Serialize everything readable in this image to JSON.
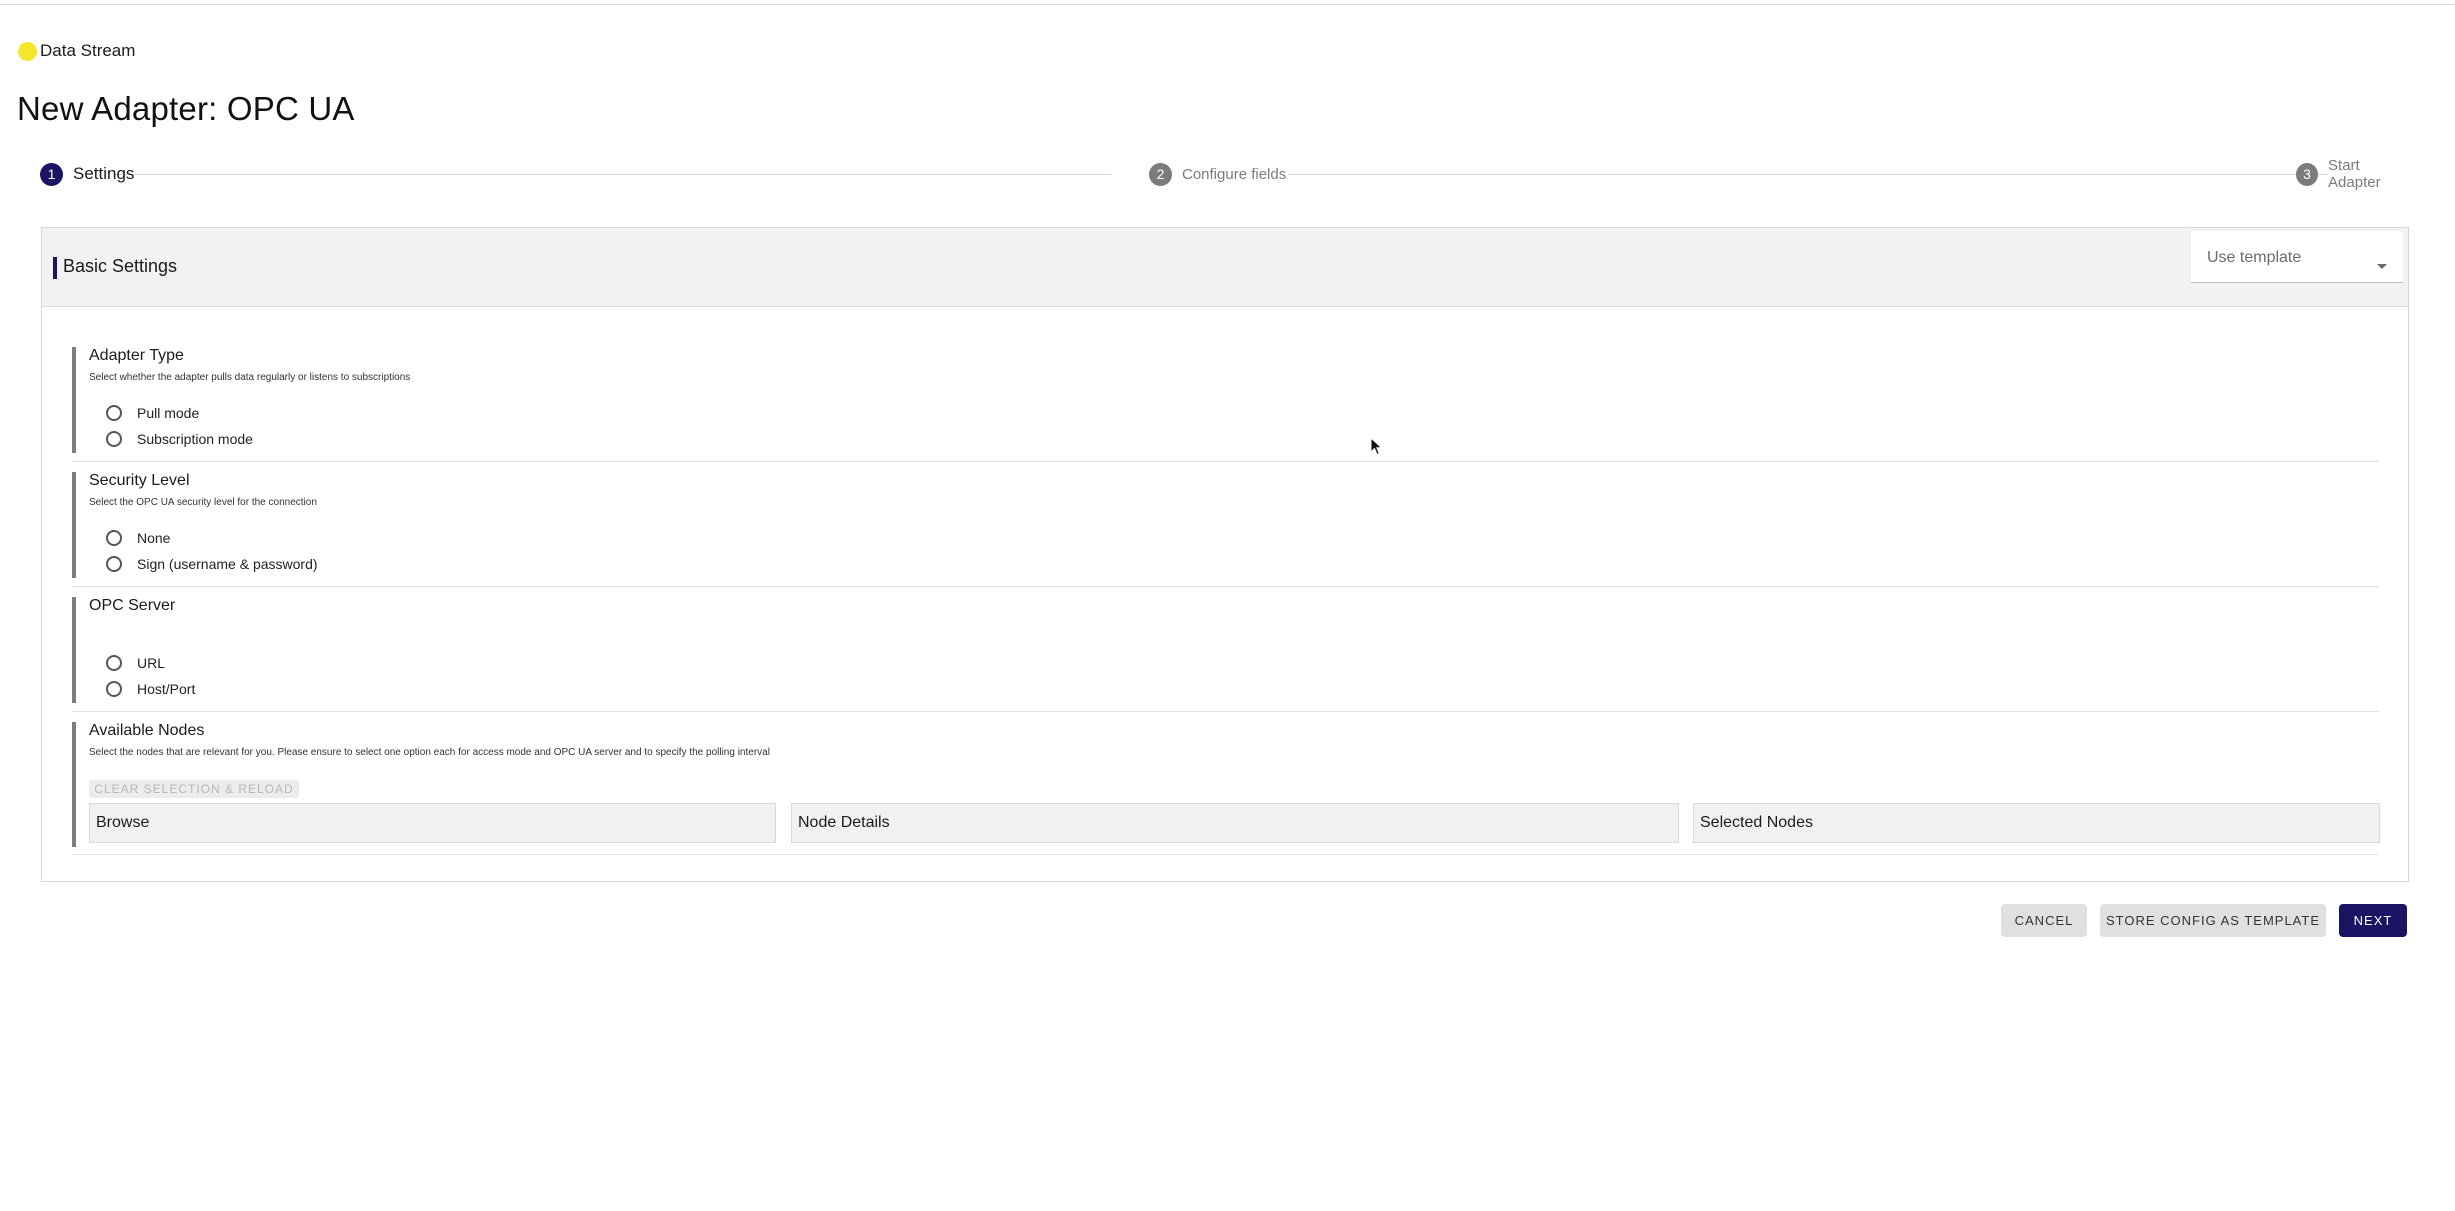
{
  "app": {
    "name": "Data Stream"
  },
  "page": {
    "title": "New Adapter: OPC UA"
  },
  "stepper": {
    "steps": [
      {
        "number": "1",
        "label": "Settings",
        "state": "active"
      },
      {
        "number": "2",
        "label": "Configure fields",
        "state": "inactive"
      },
      {
        "number": "3",
        "label": "Start Adapter",
        "state": "inactive"
      }
    ]
  },
  "settings": {
    "title": "Basic Settings",
    "template_select": {
      "selected": "Use template"
    },
    "sections": [
      {
        "title": "Adapter Type",
        "description": "Select whether the adapter pulls data regularly or listens to subscriptions",
        "options": [
          "Pull mode",
          "Subscription mode"
        ]
      },
      {
        "title": "Security Level",
        "description": "Select the OPC UA security level for the connection",
        "options": [
          "None",
          "Sign (username & password)"
        ]
      },
      {
        "title": "OPC Server",
        "description": "",
        "options": [
          "URL",
          "Host/Port"
        ]
      }
    ],
    "nodes": {
      "title": "Available Nodes",
      "description": "Select the nodes that are relevant for you. Please ensure to select one option each for access mode and OPC UA server and to specify the polling interval",
      "clear_button": "CLEAR SELECTION & RELOAD",
      "panels": [
        "Browse",
        "Node Details",
        "Selected Nodes"
      ]
    }
  },
  "actions": {
    "cancel": "CANCEL",
    "store_template": "STORE CONFIG AS TEMPLATE",
    "next": "NEXT"
  },
  "colors": {
    "primary": "#1b1464",
    "brand_dot": "#f5e62c",
    "header_bg": "#f2f2f2",
    "section_accent": "#7d7d7d"
  }
}
